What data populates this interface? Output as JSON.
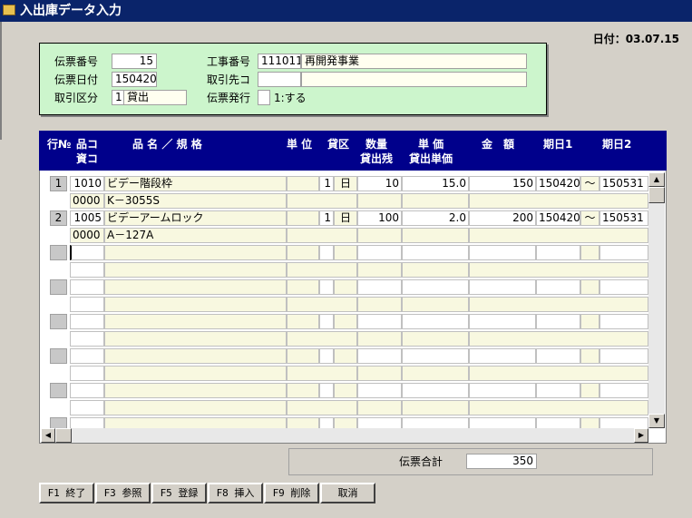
{
  "window": {
    "title": "入出庫データ入力"
  },
  "date_label": "日付：03.07.15",
  "header": {
    "slip_no_label": "伝票番号",
    "slip_no": "15",
    "slip_date_label": "伝票日付",
    "slip_date": "150420",
    "trade_type_label": "取引区分",
    "trade_type_code": "1",
    "trade_type_name": "貸出",
    "work_no_label": "工事番号",
    "work_no": "111011",
    "work_name": "再開発事業",
    "partner_label": "取引先コ",
    "partner_code": "",
    "partner_name": "",
    "issue_label": "伝票発行",
    "issue_value": "",
    "issue_hint": "1:する"
  },
  "grid": {
    "headers": {
      "row_no": "行№",
      "item_code": "品コ",
      "asset_code": "資コ",
      "name_spec": "品 名 ／ 規 格",
      "unit": "単 位",
      "loan_type": "貸区",
      "qty": "数量",
      "loan_balance": "貸出残",
      "unit_price": "単 価",
      "loan_unit_price": "貸出単価",
      "amount": "金　額",
      "date1": "期日1",
      "date2": "期日2"
    },
    "rows": [
      {
        "row_no": "1",
        "item_code": "1010",
        "name": "ビデー階段枠",
        "unit": "",
        "loan_type": "1",
        "loan_type_name": "日",
        "qty": "10",
        "unit_price": "15.0",
        "amount": "150",
        "date1": "150420",
        "tilde": "〜",
        "date2": "150531",
        "asset_code": "0000",
        "spec": "K－3055S"
      },
      {
        "row_no": "2",
        "item_code": "1005",
        "name": "ビデーアームロック",
        "unit": "",
        "loan_type": "1",
        "loan_type_name": "日",
        "qty": "100",
        "unit_price": "2.0",
        "amount": "200",
        "date1": "150420",
        "tilde": "〜",
        "date2": "150531",
        "asset_code": "0000",
        "spec": "A－127A"
      }
    ]
  },
  "total": {
    "label": "伝票合計",
    "value": "350"
  },
  "function_keys": [
    {
      "label": "F1 終了"
    },
    {
      "label": "F3 参照"
    },
    {
      "label": "F5 登録"
    },
    {
      "label": "F8 挿入"
    },
    {
      "label": "F9 削除"
    },
    {
      "label": "取消"
    }
  ]
}
